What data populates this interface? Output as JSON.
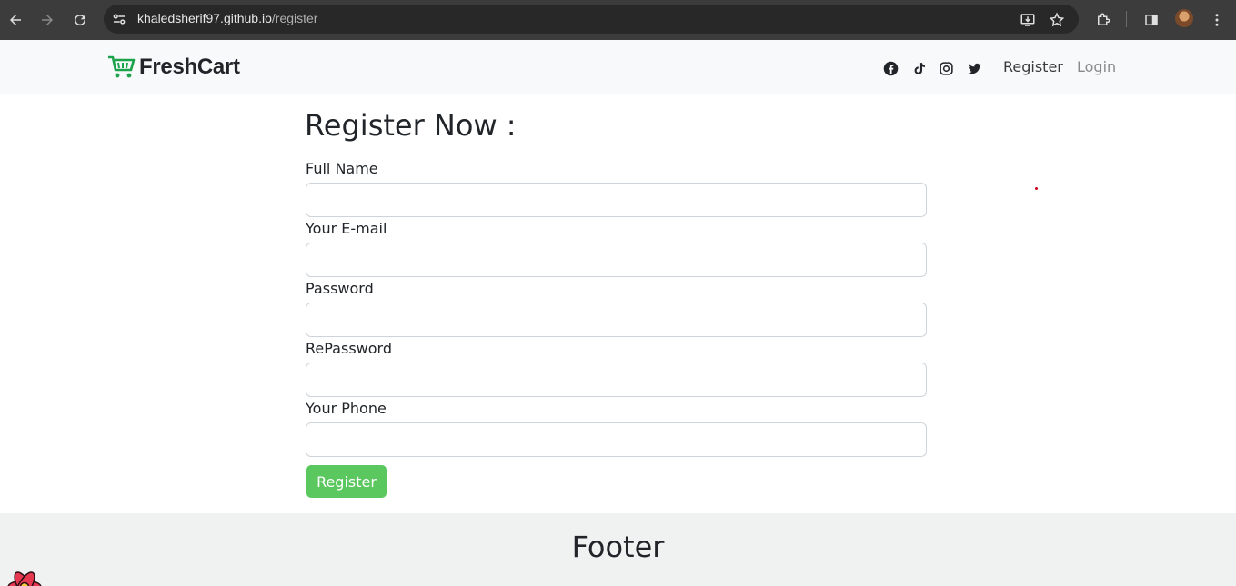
{
  "browser": {
    "url_host": "khaledsherif97.github.io",
    "url_path": "/register"
  },
  "navbar": {
    "brand": "FreshCart",
    "social_icons": [
      "facebook-icon",
      "tiktok-icon",
      "instagram-icon",
      "twitter-icon"
    ],
    "links": {
      "register": "Register",
      "login": "Login"
    }
  },
  "form": {
    "title": "Register Now :",
    "fields": [
      {
        "label": "Full Name",
        "value": ""
      },
      {
        "label": "Your E-mail",
        "value": ""
      },
      {
        "label": "Password",
        "value": ""
      },
      {
        "label": "RePassword",
        "value": ""
      },
      {
        "label": "Your Phone",
        "value": ""
      }
    ],
    "submit_label": "Register"
  },
  "footer": {
    "title": "Footer"
  },
  "colors": {
    "accent": "#5bc75f",
    "brand_cart": "#1aa34a",
    "navbar_bg": "#f8f9fa",
    "footer_bg": "#f0f2f2"
  }
}
